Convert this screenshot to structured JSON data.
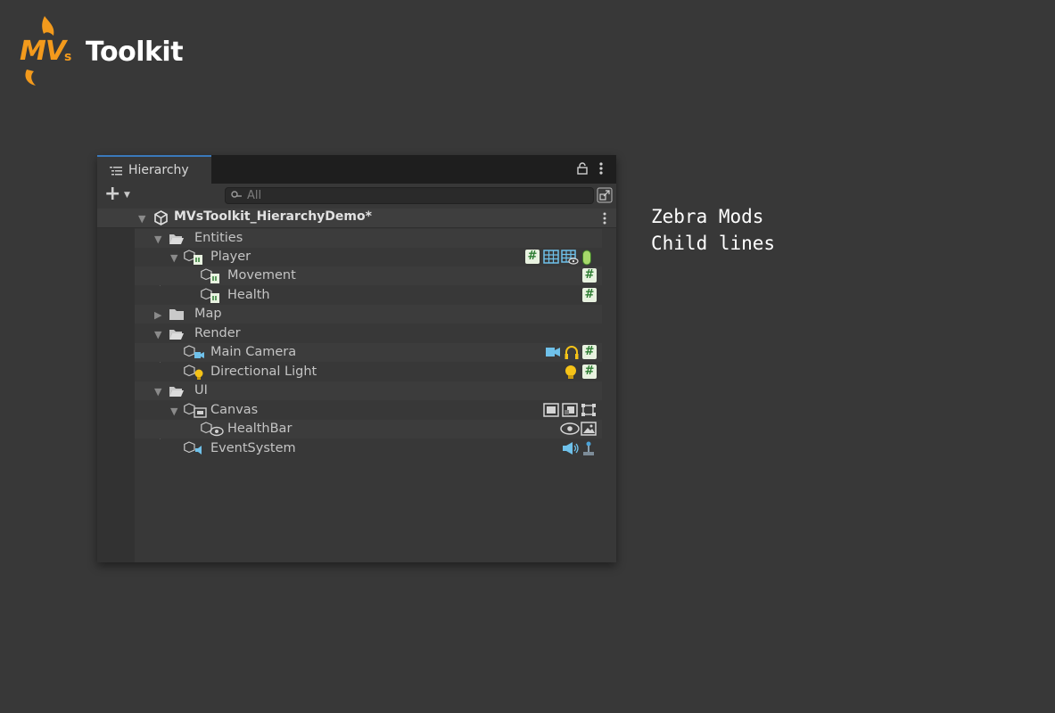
{
  "logo": {
    "mv": "MV",
    "s": "s",
    "toolkit": "Toolkit"
  },
  "notes": {
    "line1": "Zebra Mods",
    "line2": "Child lines"
  },
  "window": {
    "tab_label": "Hierarchy",
    "search_placeholder": "All"
  },
  "scene": {
    "name": "MVsToolkit_HierarchyDemo*"
  },
  "rows": [
    {
      "name": "Entities",
      "type": "folder",
      "expanded": true
    },
    {
      "name": "Player",
      "type": "gameobject",
      "expanded": true,
      "components": [
        "script-icon",
        "grid-icon",
        "grid-eye-icon",
        "capsule-collider-icon"
      ]
    },
    {
      "name": "Movement",
      "type": "gameobject",
      "components": [
        "script-icon"
      ]
    },
    {
      "name": "Health",
      "type": "gameobject",
      "components": [
        "script-icon"
      ]
    },
    {
      "name": "Map",
      "type": "folder",
      "expanded": false
    },
    {
      "name": "Render",
      "type": "folder",
      "expanded": true
    },
    {
      "name": "Main Camera",
      "type": "camera",
      "components": [
        "camera-icon",
        "audio-listener-icon",
        "script-icon"
      ]
    },
    {
      "name": "Directional Light",
      "type": "light",
      "components": [
        "light-icon",
        "script-icon"
      ]
    },
    {
      "name": "UI",
      "type": "folder",
      "expanded": true
    },
    {
      "name": "Canvas",
      "type": "canvas",
      "expanded": true,
      "components": [
        "canvas-icon",
        "canvas-scaler-icon",
        "rect-transform-icon"
      ]
    },
    {
      "name": "HealthBar",
      "type": "image",
      "components": [
        "eye-icon",
        "image-icon"
      ]
    },
    {
      "name": "EventSystem",
      "type": "eventsystem",
      "components": [
        "event-system-icon",
        "input-module-icon"
      ]
    }
  ],
  "colors": {
    "accent": "#3a79bb",
    "logo_orange": "#f39a1c",
    "script_green": "#2d7d32"
  }
}
